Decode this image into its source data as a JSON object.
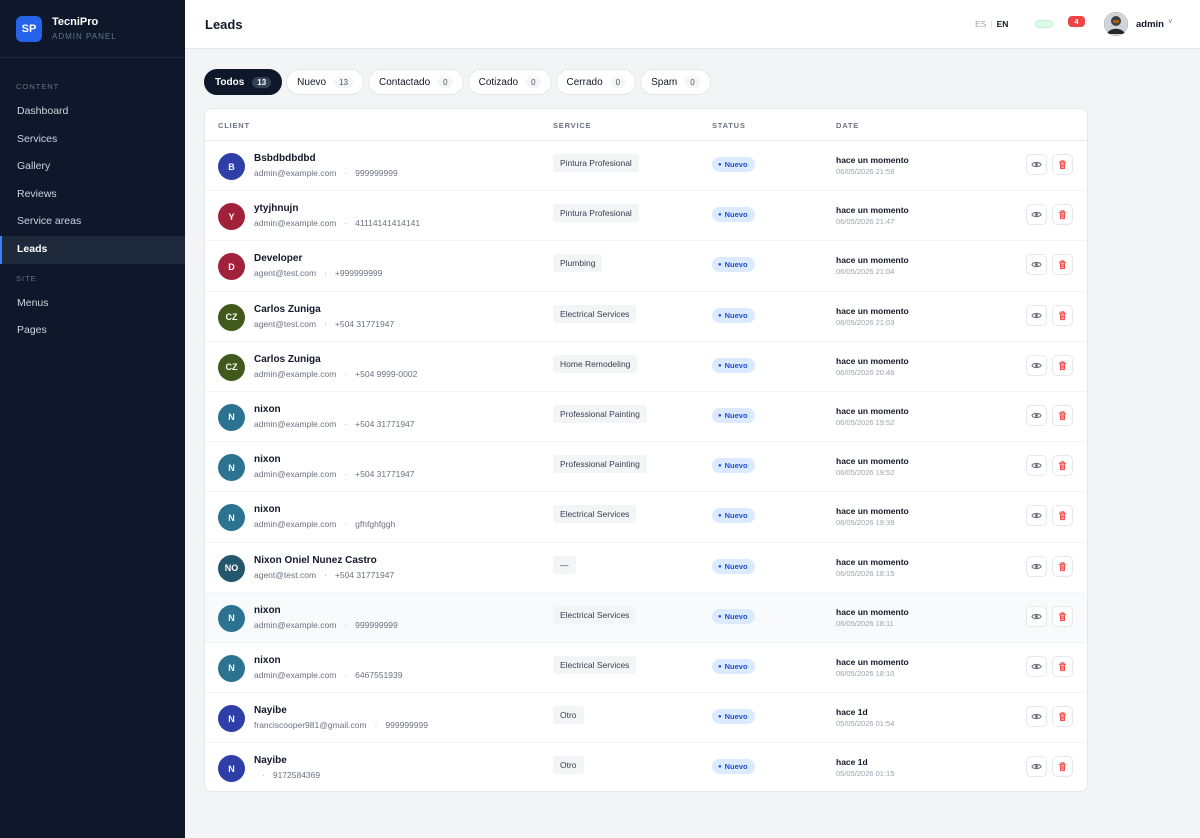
{
  "brand": {
    "logo": "SP",
    "name": "TecniPro",
    "subtitle": "ADMIN PANEL"
  },
  "sidebar": {
    "section_content": "CONTENT",
    "content_items": [
      {
        "label": "Dashboard"
      },
      {
        "label": "Services"
      },
      {
        "label": "Gallery"
      },
      {
        "label": "Reviews"
      },
      {
        "label": "Service areas"
      },
      {
        "label": "Leads",
        "active": true
      }
    ],
    "section_site": "SITE",
    "site_items": [
      {
        "label": "Menus"
      },
      {
        "label": "Pages"
      }
    ]
  },
  "header": {
    "title": "Leads",
    "lang_es": "ES",
    "lang_sep": "|",
    "lang_en": "EN",
    "notification_count": "4",
    "user_name": "admin",
    "caret": "˅"
  },
  "tabs": [
    {
      "label": "Todos",
      "count": "13",
      "active": true
    },
    {
      "label": "Nuevo",
      "count": "13"
    },
    {
      "label": "Contactado",
      "count": "0"
    },
    {
      "label": "Cotizado",
      "count": "0"
    },
    {
      "label": "Cerrado",
      "count": "0"
    },
    {
      "label": "Spam",
      "count": "0"
    }
  ],
  "table": {
    "columns": {
      "client": "CLIENT",
      "service": "SERVICE",
      "status": "STATUS",
      "date": "DATE"
    },
    "rows": [
      {
        "initials": "B",
        "color": "#2e3fa8",
        "name": "Bsbdbdbdbd",
        "email": "admin@example.com",
        "phone": "999999999",
        "service": "Pintura Profesional",
        "status": "Nuevo",
        "relative": "hace un momento",
        "date": "06/05/2026 21:58"
      },
      {
        "initials": "Y",
        "color": "#a1213a",
        "name": "ytyjhnujn",
        "email": "admin@example.com",
        "phone": "41114141414141",
        "service": "Pintura Profesional",
        "status": "Nuevo",
        "relative": "hace un momento",
        "date": "06/05/2026 21:47"
      },
      {
        "initials": "D",
        "color": "#a1213a",
        "name": "Developer",
        "email": "agent@test.com",
        "phone": "+999999999",
        "service": "Plumbing",
        "status": "Nuevo",
        "relative": "hace un momento",
        "date": "06/05/2026 21:04"
      },
      {
        "initials": "CZ",
        "color": "#3f5a1c",
        "name": "Carlos Zuniga",
        "email": "agent@test.com",
        "phone": "+504 31771947",
        "service": "Electrical Services",
        "status": "Nuevo",
        "relative": "hace un momento",
        "date": "06/05/2026 21:03"
      },
      {
        "initials": "CZ",
        "color": "#3f5a1c",
        "name": "Carlos Zuniga",
        "email": "admin@example.com",
        "phone": "+504 9999-0002",
        "service": "Home Remodeling",
        "status": "Nuevo",
        "relative": "hace un momento",
        "date": "06/05/2026 20:46"
      },
      {
        "initials": "N",
        "color": "#2b7390",
        "name": "nixon",
        "email": "admin@example.com",
        "phone": "+504 31771947",
        "service": "Professional Painting",
        "status": "Nuevo",
        "relative": "hace un momento",
        "date": "06/05/2026 19:52"
      },
      {
        "initials": "N",
        "color": "#2b7390",
        "name": "nixon",
        "email": "admin@example.com",
        "phone": "+504 31771947",
        "service": "Professional Painting",
        "status": "Nuevo",
        "relative": "hace un momento",
        "date": "06/05/2026 19:52"
      },
      {
        "initials": "N",
        "color": "#2b7390",
        "name": "nixon",
        "email": "admin@example.com",
        "phone": "gfhfghfggh",
        "service": "Electrical Services",
        "status": "Nuevo",
        "relative": "hace un momento",
        "date": "06/05/2026 19:39"
      },
      {
        "initials": "NO",
        "color": "#24566e",
        "name": "Nixon Oniel Nunez Castro",
        "email": "agent@test.com",
        "phone": "+504 31771947",
        "service": "—",
        "status": "Nuevo",
        "relative": "hace un momento",
        "date": "06/05/2026 18:15"
      },
      {
        "initials": "N",
        "color": "#2b7390",
        "name": "nixon",
        "email": "admin@example.com",
        "phone": "999999999",
        "service": "Electrical Services",
        "status": "Nuevo",
        "relative": "hace un momento",
        "date": "06/05/2026 18:11",
        "hover": true
      },
      {
        "initials": "N",
        "color": "#2b7390",
        "name": "nixon",
        "email": "admin@example.com",
        "phone": "6467551939",
        "service": "Electrical Services",
        "status": "Nuevo",
        "relative": "hace un momento",
        "date": "06/05/2026 18:10"
      },
      {
        "initials": "N",
        "color": "#2e3fa8",
        "name": "Nayibe",
        "email": "franciscooper981@gmail.com",
        "phone": "999999999",
        "service": "Otro",
        "status": "Nuevo",
        "relative": "hace 1d",
        "date": "05/05/2026 01:54"
      },
      {
        "initials": "N",
        "color": "#2e3fa8",
        "name": "Nayibe",
        "email": "",
        "phone": "9172584369",
        "service": "Otro",
        "status": "Nuevo",
        "relative": "hace 1d",
        "date": "05/05/2026 01:15"
      }
    ]
  },
  "icons": {
    "view": "eye-icon",
    "delete": "trash-icon",
    "notifications": "bell-icon"
  },
  "colors": {
    "sidebar_bg": "#0f172a",
    "accent": "#2563eb",
    "status_bg": "#dbeafe",
    "status_text": "#1d4ed8",
    "danger": "#ef4444"
  }
}
